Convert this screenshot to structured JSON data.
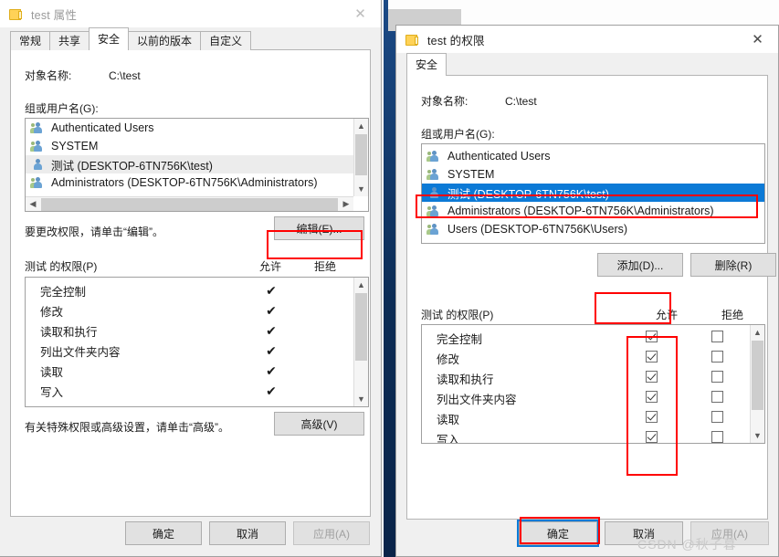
{
  "desktop": {
    "background_color": "#0d2f5e"
  },
  "watermark": {
    "text": "CSDN @秋子暮"
  },
  "properties_window": {
    "title": "test 属性",
    "title_icon": "folder-icon",
    "close_icon": "close-icon",
    "tabs": [
      {
        "label": "常规",
        "active": false
      },
      {
        "label": "共享",
        "active": false
      },
      {
        "label": "安全",
        "active": true
      },
      {
        "label": "以前的版本",
        "active": false
      },
      {
        "label": "自定义",
        "active": false
      }
    ],
    "object_name_label": "对象名称:",
    "object_name_value": "C:\\test",
    "group_user_label": "组或用户名(G):",
    "users": [
      {
        "name": "Authenticated Users",
        "type": "group",
        "selected": false
      },
      {
        "name": "SYSTEM",
        "type": "group",
        "selected": false
      },
      {
        "name": "测试 (DESKTOP-6TN756K\\test)",
        "type": "user",
        "selected": false,
        "soft": true
      },
      {
        "name": "Administrators (DESKTOP-6TN756K\\Administrators)",
        "type": "group",
        "selected": false
      }
    ],
    "edit_hint": "要更改权限，请单击“编辑”。",
    "edit_button": "编辑(E)...",
    "permissions_label": "测试 的权限(P)",
    "allow_header": "允许",
    "deny_header": "拒绝",
    "permissions": [
      {
        "name": "完全控制",
        "allow": true,
        "deny": false
      },
      {
        "name": "修改",
        "allow": true,
        "deny": false
      },
      {
        "name": "读取和执行",
        "allow": true,
        "deny": false
      },
      {
        "name": "列出文件夹内容",
        "allow": true,
        "deny": false
      },
      {
        "name": "读取",
        "allow": true,
        "deny": false
      },
      {
        "name": "写入",
        "allow": true,
        "deny": false
      }
    ],
    "advanced_hint": "有关特殊权限或高级设置，请单击“高级”。",
    "advanced_button": "高级(V)",
    "ok_button": "确定",
    "cancel_button": "取消",
    "apply_button": "应用(A)",
    "apply_disabled": true
  },
  "permissions_window": {
    "title": "test 的权限",
    "title_icon": "folder-icon",
    "close_icon": "close-icon",
    "tabs": [
      {
        "label": "安全",
        "active": true
      }
    ],
    "object_name_label": "对象名称:",
    "object_name_value": "C:\\test",
    "group_user_label": "组或用户名(G):",
    "users": [
      {
        "name": "Authenticated Users",
        "type": "group",
        "selected": false
      },
      {
        "name": "SYSTEM",
        "type": "group",
        "selected": false
      },
      {
        "name": "测试 (DESKTOP-6TN756K\\test)",
        "type": "user",
        "selected": true
      },
      {
        "name": "Administrators (DESKTOP-6TN756K\\Administrators)",
        "type": "group",
        "selected": false
      },
      {
        "name": "Users (DESKTOP-6TN756K\\Users)",
        "type": "group",
        "selected": false
      }
    ],
    "add_button": "添加(D)...",
    "remove_button": "删除(R)",
    "permissions_label": "测试 的权限(P)",
    "allow_header": "允许",
    "deny_header": "拒绝",
    "permissions": [
      {
        "name": "完全控制",
        "allow": true,
        "deny": false
      },
      {
        "name": "修改",
        "allow": true,
        "deny": false
      },
      {
        "name": "读取和执行",
        "allow": true,
        "deny": false
      },
      {
        "name": "列出文件夹内容",
        "allow": true,
        "deny": false
      },
      {
        "name": "读取",
        "allow": true,
        "deny": false
      },
      {
        "name": "写入",
        "allow": true,
        "deny": false
      }
    ],
    "ok_button": "确定",
    "cancel_button": "取消",
    "apply_button": "应用(A)",
    "apply_disabled": true
  },
  "annotations": {
    "accent_color": "#ff0000",
    "focus_color": "#0c7ad6"
  }
}
